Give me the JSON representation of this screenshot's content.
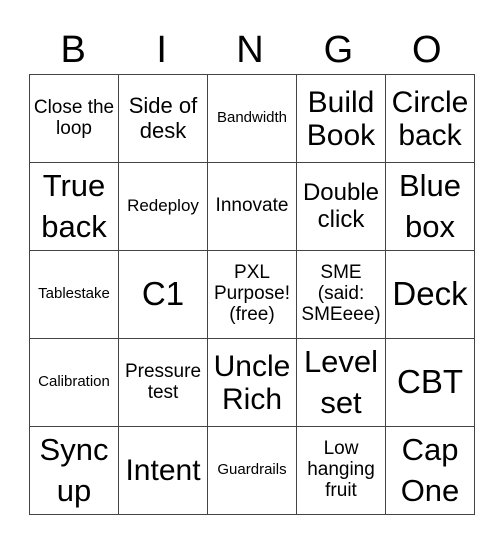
{
  "header": {
    "letters": [
      "B",
      "I",
      "N",
      "G",
      "O"
    ]
  },
  "board": {
    "rows": [
      [
        "Close the loop",
        "Side of desk",
        "Bandwidth",
        "Build Book",
        "Circle back"
      ],
      [
        "True back",
        "Redeploy",
        "Innovate",
        "Double click",
        "Blue box"
      ],
      [
        "Tablestake",
        "C1",
        "PXL Purpose! (free)",
        "SME (said: SMEeee)",
        "Deck"
      ],
      [
        "Calibration",
        "Pressure test",
        "Uncle Rich",
        "Level set",
        "CBT"
      ],
      [
        "Sync up",
        "Intent",
        "Guardrails",
        "Low hanging fruit",
        "Cap One"
      ]
    ]
  }
}
